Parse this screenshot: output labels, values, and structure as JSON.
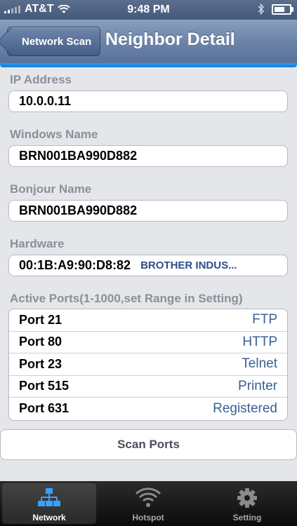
{
  "status_bar": {
    "carrier": "AT&T",
    "time": "9:48 PM"
  },
  "nav": {
    "back_label": "Network Scan",
    "title": "Neighbor Detail"
  },
  "fields": {
    "ip_label": "IP Address",
    "ip_value": "10.0.0.11",
    "windows_label": "Windows Name",
    "windows_value": "BRN001BA990D882",
    "bonjour_label": "Bonjour Name",
    "bonjour_value": "BRN001BA990D882",
    "hardware_label": "Hardware",
    "hardware_mac": "00:1B:A9:90:D8:82",
    "hardware_vendor": "BROTHER INDUS..."
  },
  "ports": {
    "label": "Active Ports(1-1000,set Range in Setting)",
    "rows": [
      {
        "port": "Port 21",
        "service": "FTP"
      },
      {
        "port": "Port 80",
        "service": "HTTP"
      },
      {
        "port": "Port 23",
        "service": "Telnet"
      },
      {
        "port": "Port 515",
        "service": "Printer"
      },
      {
        "port": "Port 631",
        "service": "Registered"
      }
    ]
  },
  "scan_button": "Scan Ports",
  "tabs": [
    {
      "label": "Network",
      "icon": "network-icon",
      "active": true
    },
    {
      "label": "Hotspot",
      "icon": "wifi-icon",
      "active": false
    },
    {
      "label": "Setting",
      "icon": "gear-icon",
      "active": false
    }
  ],
  "colors": {
    "accent": "#1e88e5",
    "port_service": "#3c5f93",
    "vendor": "#2d4d8a"
  }
}
